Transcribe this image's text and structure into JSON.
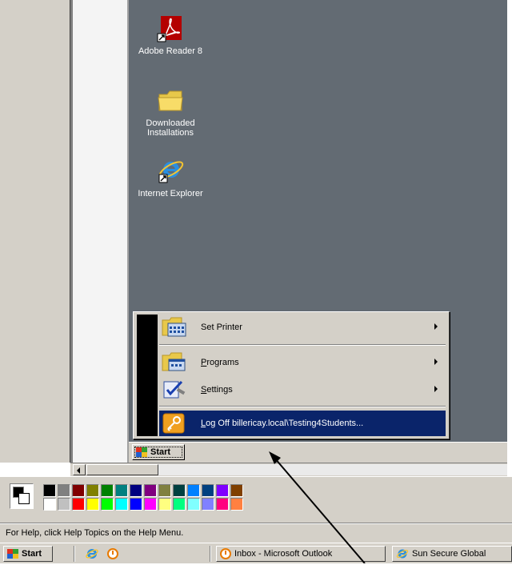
{
  "desktop": {
    "icons": [
      {
        "label": "Adobe Reader 8",
        "icon": "adobe-reader-icon"
      },
      {
        "label": "Downloaded Installations",
        "icon": "folder-icon"
      },
      {
        "label": "Internet Explorer",
        "icon": "internet-explorer-icon"
      }
    ]
  },
  "start_menu": {
    "items": [
      {
        "label": "Set Printer",
        "icon": "printer-folder-icon",
        "has_submenu": true
      },
      {
        "label_pre": "",
        "label_ul": "P",
        "label_post": "rograms",
        "icon": "programs-folder-icon",
        "has_submenu": true
      },
      {
        "label_pre": "",
        "label_ul": "S",
        "label_post": "ettings",
        "icon": "settings-icon",
        "has_submenu": true
      },
      {
        "label_pre": "",
        "label_ul": "L",
        "label_post": "og Off billericay.local\\Testing4Students...",
        "icon": "key-icon",
        "has_submenu": false,
        "selected": true
      }
    ],
    "start_button_label": "Start"
  },
  "palette": {
    "top_row": [
      "#000000",
      "#808080",
      "#800000",
      "#808000",
      "#008000",
      "#008080",
      "#000080",
      "#800080",
      "#808040",
      "#004040",
      "#0080ff",
      "#004080",
      "#8000ff",
      "#804000"
    ],
    "bottom_row": [
      "#ffffff",
      "#c0c0c0",
      "#ff0000",
      "#ffff00",
      "#00ff00",
      "#00ffff",
      "#0000ff",
      "#ff00ff",
      "#ffff80",
      "#00ff80",
      "#80ffff",
      "#8080ff",
      "#ff0080",
      "#ff8040"
    ]
  },
  "status_bar": {
    "text": "For Help, click Help Topics on the Help Menu."
  },
  "taskbar": {
    "start_label": "Start",
    "buttons": [
      {
        "label": "Inbox - Microsoft Outlook",
        "icon": "outlook-clock-icon"
      },
      {
        "label": "Sun Secure Global",
        "icon": "internet-explorer-icon"
      }
    ]
  },
  "colors": {
    "desktop_bg": "#636b73",
    "selection": "#0a246a",
    "face": "#d4d0c8"
  }
}
